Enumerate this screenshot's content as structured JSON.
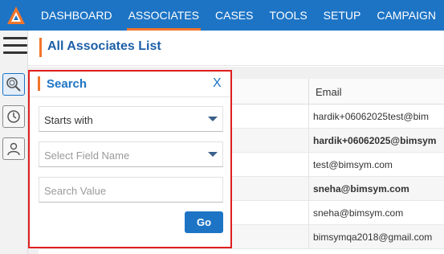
{
  "nav": {
    "logo_icon": "brand-logo-icon",
    "items": [
      {
        "label": "DASHBOARD"
      },
      {
        "label": "ASSOCIATES",
        "active": true
      },
      {
        "label": "CASES"
      },
      {
        "label": "TOOLS"
      },
      {
        "label": "SETUP"
      },
      {
        "label": "CAMPAIGN"
      }
    ],
    "accent": "#f2752a",
    "background": "#1d74c5"
  },
  "rail": {
    "icons": [
      "hamburger-menu-icon",
      "search-icon",
      "history-icon",
      "user-icon"
    ]
  },
  "page": {
    "title": "All Associates List"
  },
  "table": {
    "columns": [
      "Email"
    ],
    "rows": [
      {
        "email": "hardik+06062025test@bim",
        "bold": false
      },
      {
        "email": "hardik+06062025@bimsym",
        "bold": true
      },
      {
        "email": "test@bimsym.com",
        "bold": false
      },
      {
        "email": "sneha@bimsym.com",
        "bold": true
      },
      {
        "email": "sneha@bimsym.com",
        "bold": false
      },
      {
        "email": "bimsymqa2018@gmail.com",
        "bold": false
      }
    ]
  },
  "search_panel": {
    "title": "Search",
    "close_label": "X",
    "match_mode": "Starts with",
    "field_placeholder": "Select Field Name",
    "value_placeholder": "Search Value",
    "go_label": "Go",
    "border_color": "#e01f1f"
  }
}
